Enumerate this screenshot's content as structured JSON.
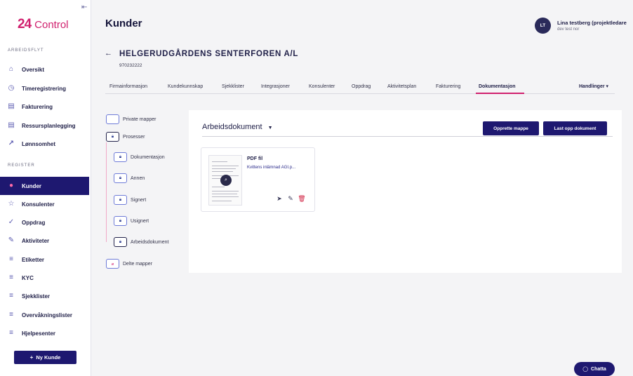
{
  "app": {
    "logo_mark": "24",
    "logo_text": "Control",
    "collapse_icon": "⇤"
  },
  "sidebar": {
    "workflow_label": "ARBEIDSFLYT",
    "workflow_items": [
      {
        "label": "Oversikt",
        "icon": "⌂"
      },
      {
        "label": "Timeregistrering",
        "icon": "◷"
      },
      {
        "label": "Fakturering",
        "icon": "▤"
      },
      {
        "label": "Ressursplanlegging",
        "icon": "▤"
      },
      {
        "label": "Lønnsomhet",
        "icon": "↗"
      }
    ],
    "register_label": "REGISTER",
    "register_items": [
      {
        "label": "Kunder",
        "icon": "●"
      },
      {
        "label": "Konsulenter",
        "icon": "☆"
      },
      {
        "label": "Oppdrag",
        "icon": "✓"
      },
      {
        "label": "Aktiviteter",
        "icon": "✎"
      },
      {
        "label": "Etiketter",
        "icon": "≡"
      },
      {
        "label": "KYC",
        "icon": "≡"
      },
      {
        "label": "Sjekklister",
        "icon": "≡"
      },
      {
        "label": "Overvåkningslister",
        "icon": "≡"
      },
      {
        "label": "Hjelpesenter",
        "icon": "≡"
      }
    ],
    "new_customer_label": "Ny Kunde",
    "new_customer_icon": "+"
  },
  "header": {
    "title": "Kunder",
    "user_initials": "LT",
    "user_name": "Lina testberg (projektledare",
    "user_org": "dev test nor"
  },
  "customer": {
    "name": "HELGERUDGÅRDENS SENTERFOREN A/L",
    "org_number": "970232222",
    "back_icon": "←"
  },
  "tabs": [
    "Firmainformasjon",
    "Kundekunnskap",
    "Sjekklister",
    "Integrasjoner",
    "Konsulenter",
    "Oppdrag",
    "Aktivitetsplan",
    "Fakturering",
    "Dokumentasjon"
  ],
  "active_tab": "Dokumentasjon",
  "actions_menu": "Handlinger",
  "folders": {
    "private": "Private mapper",
    "processes": "Prosesser",
    "children": [
      "Dokumentasjon",
      "Annen",
      "Signert",
      "Usignert",
      "Arbeidsdokument"
    ],
    "shared": "Delte mapper"
  },
  "main": {
    "doc_type": "Arbeidsdokument",
    "create_folder_label": "Opprette mappe",
    "upload_label": "Last opp dokument",
    "file": {
      "type_label": "PDF fil",
      "name": "Kvittens inlämnad AGI.p..."
    }
  },
  "chat": {
    "label": "Chatta"
  },
  "colors": {
    "brand_navy": "#1e1870",
    "accent_pink": "#d0206e",
    "delete_red": "#d02040"
  }
}
